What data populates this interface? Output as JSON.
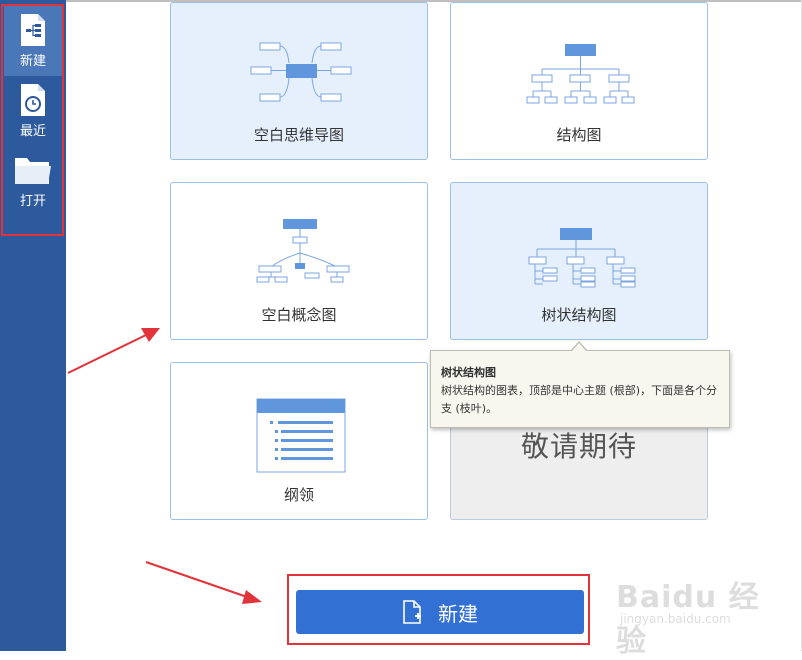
{
  "sidebar": {
    "items": [
      {
        "label": "新建",
        "icon": "new-file-icon"
      },
      {
        "label": "最近",
        "icon": "recent-clock-icon"
      },
      {
        "label": "打开",
        "icon": "folder-icon"
      }
    ]
  },
  "templates": [
    {
      "label": "空白思维导图",
      "icon": "mindmap-icon"
    },
    {
      "label": "结构图",
      "icon": "org-chart-icon"
    },
    {
      "label": "空白概念图",
      "icon": "concept-map-icon"
    },
    {
      "label": "树状结构图",
      "icon": "tree-chart-icon"
    },
    {
      "label": "纲领",
      "icon": "outline-icon"
    },
    {
      "label": "敬请期待"
    }
  ],
  "tooltip": {
    "title": "树状结构图",
    "text": "树状结构的图表，顶部是中心主题 (根部)，下面是各个分支 (枝叶)。"
  },
  "new_button": {
    "label": "新建",
    "icon": "new-file-plus-icon"
  },
  "watermark": {
    "main": "Baidu 经验",
    "sub": "jingyan.baidu.com"
  },
  "colors": {
    "sidebar": "#2d5a9c",
    "accent": "#3370d4",
    "card_border": "#9cc0e6",
    "card_highlight": "#e6f0fd",
    "annotation_red": "#e2333a"
  }
}
